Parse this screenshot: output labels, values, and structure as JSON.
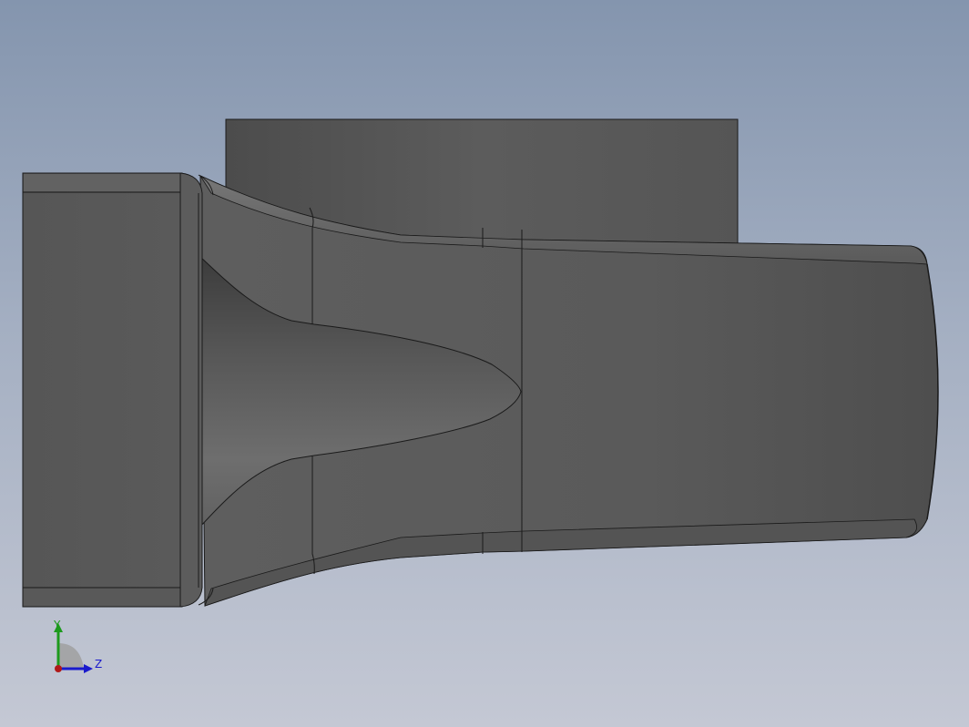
{
  "viewport": {
    "background_top": "#8495ae",
    "background_bottom": "#c4c8d4"
  },
  "model": {
    "face_color": "#5a5a5a",
    "edge_color": "#1a1a1a"
  },
  "triad": {
    "y_label": "Y",
    "z_label": "Z",
    "y_color": "#1d9a1d",
    "z_color": "#1a1acc",
    "x_color": "#b01818"
  }
}
